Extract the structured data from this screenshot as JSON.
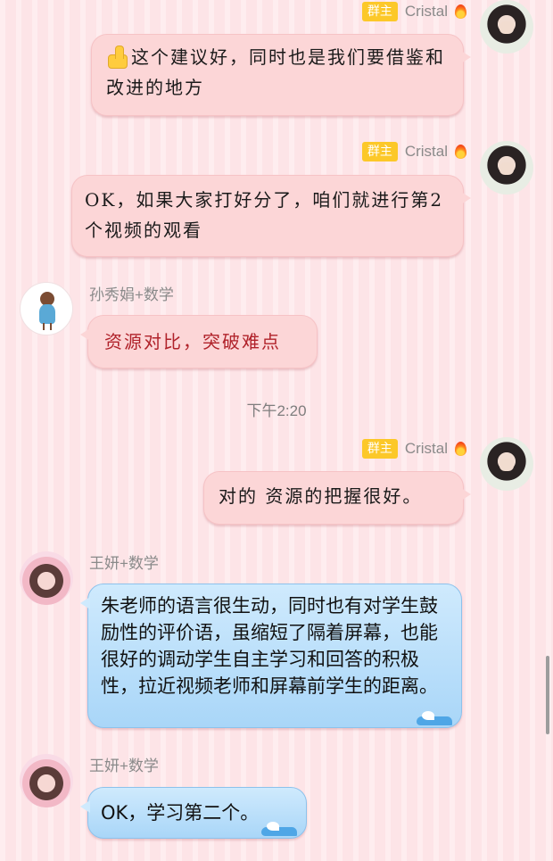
{
  "messages": [
    {
      "sender": "Cristal",
      "badge": "群主",
      "text": "这个建议好，同时也是我们要借鉴和改进的地方"
    },
    {
      "sender": "Cristal",
      "badge": "群主",
      "text": "OK，如果大家打好分了，咱们就进行第2个视频的观看"
    },
    {
      "sender": "孙秀娟+数学",
      "text": "资源对比，突破难点"
    },
    {
      "sender": "Cristal",
      "badge": "群主",
      "text": "对的 资源的把握很好。"
    },
    {
      "sender": "王妍+数学",
      "text": "朱老师的语言很生动，同时也有对学生鼓励性的评价语，虽缩短了隔着屏幕，也能很好的调动学生自主学习和回答的积极性，拉近视频老师和屏幕前学生的距离。"
    },
    {
      "sender": "王妍+数学",
      "text": "OK，学习第二个。"
    }
  ],
  "timestamp": "下午2:20",
  "icons": [
    "thumbs-up-icon",
    "flame-icon",
    "wave-icon"
  ],
  "colors": {
    "badge": "#fcc829",
    "pink_bubble": "#fcd6d7",
    "blue_bubble": "#a9d6f8",
    "background": "#fde4e7"
  }
}
